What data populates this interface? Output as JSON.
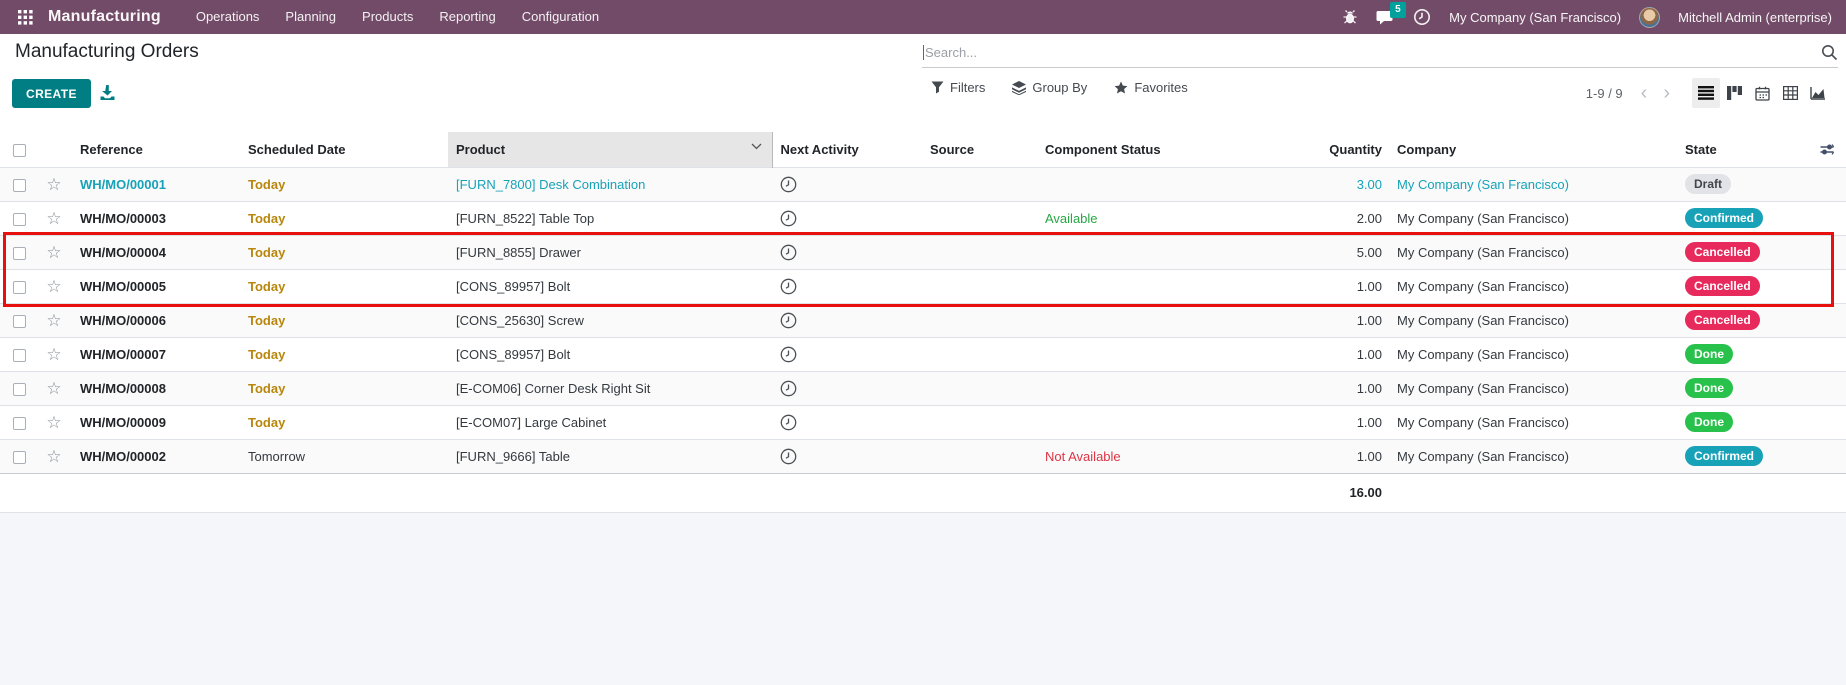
{
  "navbar": {
    "app_name": "Manufacturing",
    "menus": [
      "Operations",
      "Planning",
      "Products",
      "Reporting",
      "Configuration"
    ],
    "message_count": "5",
    "company": "My Company (San Francisco)",
    "user": "Mitchell Admin (enterprise)"
  },
  "control_panel": {
    "title": "Manufacturing Orders",
    "create_label": "CREATE",
    "search_placeholder": "Search...",
    "filters_label": "Filters",
    "group_by_label": "Group By",
    "favorites_label": "Favorites",
    "pager": "1-9 / 9",
    "pager_prev": "‹",
    "pager_next": "›"
  },
  "table": {
    "columns": [
      "Reference",
      "Scheduled Date",
      "Product",
      "Next Activity",
      "Source",
      "Component Status",
      "Quantity",
      "Company",
      "State"
    ],
    "rows": [
      {
        "reference": "WH/MO/00001",
        "scheduled_date": "Today",
        "product": "[FURN_7800] Desk Combination",
        "component_status": "",
        "quantity": "3.00",
        "company": "My Company (San Francisco)",
        "state": "Draft",
        "tone": "draft"
      },
      {
        "reference": "WH/MO/00003",
        "scheduled_date": "Today",
        "product": "[FURN_8522] Table Top",
        "component_status": "Available",
        "quantity": "2.00",
        "company": "My Company (San Francisco)",
        "state": "Confirmed"
      },
      {
        "reference": "WH/MO/00004",
        "scheduled_date": "Today",
        "product": "[FURN_8855] Drawer",
        "component_status": "",
        "quantity": "5.00",
        "company": "My Company (San Francisco)",
        "state": "Cancelled"
      },
      {
        "reference": "WH/MO/00005",
        "scheduled_date": "Today",
        "product": "[CONS_89957] Bolt",
        "component_status": "",
        "quantity": "1.00",
        "company": "My Company (San Francisco)",
        "state": "Cancelled"
      },
      {
        "reference": "WH/MO/00006",
        "scheduled_date": "Today",
        "product": "[CONS_25630] Screw",
        "component_status": "",
        "quantity": "1.00",
        "company": "My Company (San Francisco)",
        "state": "Cancelled"
      },
      {
        "reference": "WH/MO/00007",
        "scheduled_date": "Today",
        "product": "[CONS_89957] Bolt",
        "component_status": "",
        "quantity": "1.00",
        "company": "My Company (San Francisco)",
        "state": "Done"
      },
      {
        "reference": "WH/MO/00008",
        "scheduled_date": "Today",
        "product": "[E-COM06] Corner Desk Right Sit",
        "component_status": "",
        "quantity": "1.00",
        "company": "My Company (San Francisco)",
        "state": "Done"
      },
      {
        "reference": "WH/MO/00009",
        "scheduled_date": "Today",
        "product": "[E-COM07] Large Cabinet",
        "component_status": "",
        "quantity": "1.00",
        "company": "My Company (San Francisco)",
        "state": "Done"
      },
      {
        "reference": "WH/MO/00002",
        "scheduled_date": "Tomorrow",
        "product": "[FURN_9666] Table",
        "component_status": "Not Available",
        "quantity": "1.00",
        "company": "My Company (San Francisco)",
        "state": "Confirmed"
      }
    ],
    "total_quantity": "16.00"
  },
  "icons": {
    "apps_grid": "3x3-grid",
    "bug": "bug",
    "messages": "speech-bubble",
    "activities": "clock",
    "export": "download-tray",
    "filters": "funnel",
    "group_by": "layers",
    "favorites": "star",
    "search": "magnifier",
    "sort": "chevron-down",
    "row_favorite": "star-outline",
    "row_activity": "clock",
    "optional_columns": "sliders",
    "views": [
      "list",
      "kanban",
      "calendar",
      "pivot",
      "graph"
    ]
  },
  "colors": {
    "navbar": "#714B67",
    "primary": "#017E84",
    "draft_row_text": "#17a2b8",
    "today": "#b8860b",
    "available": "#28a745",
    "not_available": "#dc3545",
    "badge_draft_bg": "#e2e3e6",
    "badge_confirmed_bg": "#17a2b8",
    "badge_cancelled_bg": "#e7295c",
    "badge_done_bg": "#28c14b",
    "message_badge": "#00A09D",
    "annotation": "#e8100e"
  }
}
